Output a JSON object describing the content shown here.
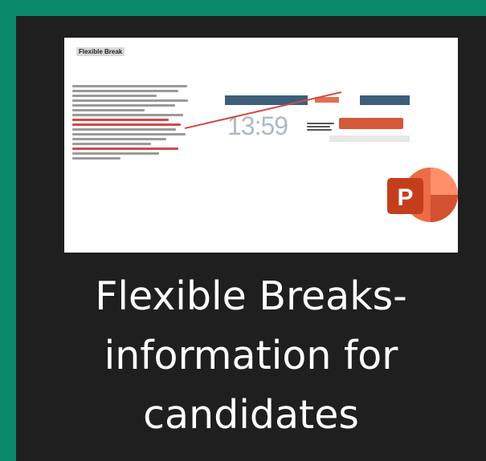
{
  "tile": {
    "title": "Flexible Breaks-\ninformation for\ncandidates",
    "thumbnail": {
      "slide_title": "Flexible Break",
      "clock_text": "13:59",
      "app_icon": "powerpoint-icon"
    }
  },
  "colors": {
    "page_background": "#0a8a6a",
    "tile_background": "#1f1f1f",
    "caption_text": "#ffffff",
    "powerpoint_brand": "#c43e1c"
  }
}
